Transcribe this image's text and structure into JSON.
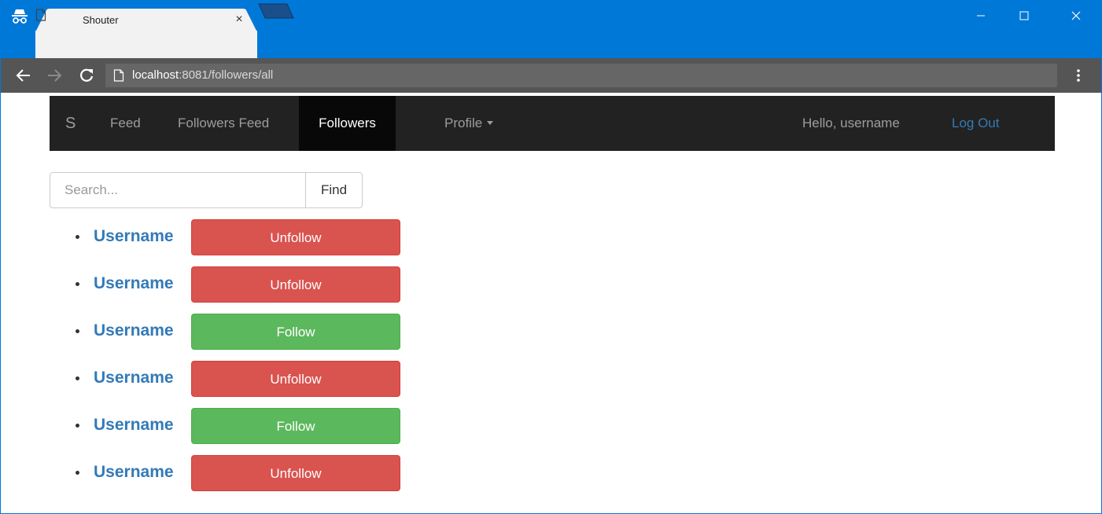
{
  "browser": {
    "tab_title": "Shouter",
    "tab_close": "×",
    "url_host": "localhost",
    "url_rest": ":8081/followers/all",
    "colors": {
      "titlebar": "#0078d7",
      "toolbar": "#555555"
    },
    "icons": [
      "incognito-icon",
      "page-icon",
      "close-icon",
      "back-arrow-icon",
      "forward-arrow-icon",
      "reload-icon",
      "menu-dots-icon",
      "minimize-icon",
      "maximize-icon"
    ]
  },
  "navbar": {
    "brand": "S",
    "items": [
      {
        "label": "Feed",
        "active": false
      },
      {
        "label": "Followers Feed",
        "active": false
      },
      {
        "label": "Followers",
        "active": true
      }
    ],
    "profile": "Profile",
    "greeting": "Hello, username",
    "logout": "Log Out",
    "colors": {
      "background": "#222222",
      "active": "#080808",
      "link": "#337ab7"
    }
  },
  "search": {
    "placeholder": "Search...",
    "value": "",
    "button": "Find"
  },
  "followers": [
    {
      "username": "Username",
      "action": "Unfollow"
    },
    {
      "username": "Username",
      "action": "Unfollow"
    },
    {
      "username": "Username",
      "action": "Follow"
    },
    {
      "username": "Username",
      "action": "Unfollow"
    },
    {
      "username": "Username",
      "action": "Follow"
    },
    {
      "username": "Username",
      "action": "Unfollow"
    }
  ],
  "colors": {
    "unfollow": "#d9534f",
    "follow": "#5cb85c",
    "username": "#337ab7"
  }
}
